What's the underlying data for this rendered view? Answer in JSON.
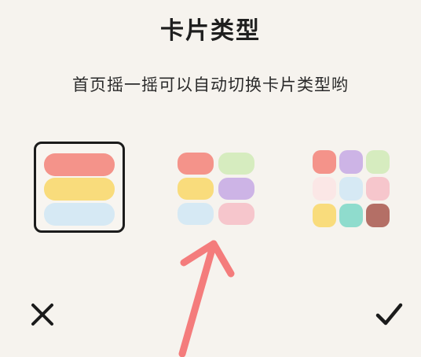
{
  "dialog": {
    "title": "卡片类型",
    "subtitle": "首页摇一摇可以自动切换卡片类型哟"
  },
  "options": [
    {
      "layout": "list",
      "selected": true,
      "colors": [
        "#f4938a",
        "#f9dc7c",
        "#d6e9f4"
      ]
    },
    {
      "layout": "grid-2x3",
      "selected": false,
      "colors": [
        "#f4938a",
        "#d6ecbf",
        "#f9dc7c",
        "#cdb4e6",
        "#d6e9f4",
        "#f6c6cc"
      ]
    },
    {
      "layout": "grid-3x3",
      "selected": false,
      "colors": [
        "#f4938a",
        "#cdb4e6",
        "#d6ecbf",
        "#fbe7e6",
        "#d6e9f4",
        "#f6c6cc",
        "#f9dc7c",
        "#8fdccd",
        "#b46f66"
      ]
    }
  ],
  "actions": {
    "cancel_icon": "close-icon",
    "confirm_icon": "check-icon"
  },
  "annotation": {
    "color": "#f47c7c"
  }
}
